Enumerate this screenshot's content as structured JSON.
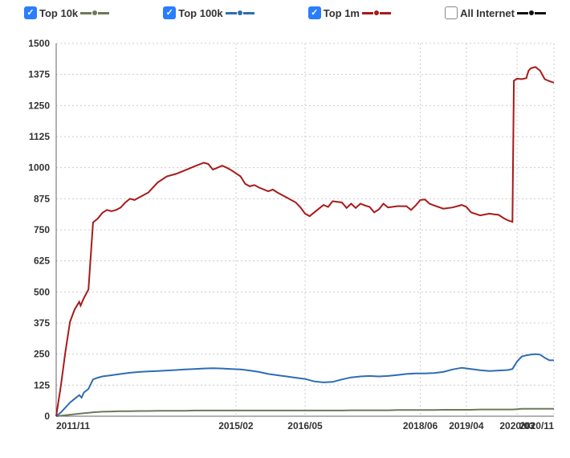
{
  "legend": {
    "items": [
      {
        "label": "Top 10k",
        "checked": true,
        "dot": "#6d7a5a",
        "line": "#6d7a5a"
      },
      {
        "label": "Top 100k",
        "checked": true,
        "dot": "#2e6db5",
        "line": "#2e6db5"
      },
      {
        "label": "Top 1m",
        "checked": true,
        "dot": "#a81a1a",
        "line": "#a81a1a"
      },
      {
        "label": "All Internet",
        "checked": false,
        "dot": "#111111",
        "line": "#111111"
      }
    ]
  },
  "chart_data": {
    "type": "line",
    "xlabel": "",
    "ylabel": "",
    "ylim": [
      0,
      1500
    ],
    "yticks": [
      0,
      125,
      250,
      375,
      500,
      625,
      750,
      875,
      1000,
      1125,
      1250,
      1375,
      1500
    ],
    "xticks": [
      {
        "t": 0,
        "label": "2011/11"
      },
      {
        "t": 39,
        "label": "2015/02"
      },
      {
        "t": 54,
        "label": "2016/05"
      },
      {
        "t": 79,
        "label": "2018/06"
      },
      {
        "t": 89,
        "label": "2019/04"
      },
      {
        "t": 100,
        "label": "2020/03"
      },
      {
        "t": 108,
        "label": "2020/11"
      }
    ],
    "x_range": [
      0,
      108
    ],
    "series": [
      {
        "name": "Top 10k",
        "color": "#6d7a5a",
        "points": [
          [
            0,
            0
          ],
          [
            1,
            2
          ],
          [
            2,
            4
          ],
          [
            3,
            6
          ],
          [
            4,
            8
          ],
          [
            5,
            10
          ],
          [
            6,
            12
          ],
          [
            7,
            14
          ],
          [
            8,
            16
          ],
          [
            9,
            17
          ],
          [
            10,
            18
          ],
          [
            12,
            19
          ],
          [
            14,
            20
          ],
          [
            16,
            20
          ],
          [
            18,
            21
          ],
          [
            20,
            21
          ],
          [
            22,
            22
          ],
          [
            24,
            22
          ],
          [
            26,
            22
          ],
          [
            28,
            22
          ],
          [
            30,
            23
          ],
          [
            32,
            23
          ],
          [
            34,
            23
          ],
          [
            36,
            23
          ],
          [
            38,
            23
          ],
          [
            40,
            23
          ],
          [
            42,
            23
          ],
          [
            44,
            23
          ],
          [
            46,
            23
          ],
          [
            48,
            23
          ],
          [
            50,
            23
          ],
          [
            52,
            23
          ],
          [
            54,
            23
          ],
          [
            56,
            23
          ],
          [
            58,
            23
          ],
          [
            60,
            23
          ],
          [
            62,
            23
          ],
          [
            64,
            24
          ],
          [
            66,
            24
          ],
          [
            68,
            24
          ],
          [
            70,
            24
          ],
          [
            72,
            24
          ],
          [
            74,
            25
          ],
          [
            76,
            25
          ],
          [
            78,
            25
          ],
          [
            80,
            25
          ],
          [
            82,
            25
          ],
          [
            84,
            26
          ],
          [
            86,
            26
          ],
          [
            88,
            26
          ],
          [
            90,
            26
          ],
          [
            92,
            27
          ],
          [
            94,
            27
          ],
          [
            96,
            27
          ],
          [
            98,
            27
          ],
          [
            99,
            27
          ],
          [
            100,
            28
          ],
          [
            101,
            30
          ],
          [
            102,
            30
          ],
          [
            103,
            30
          ],
          [
            104,
            30
          ],
          [
            105,
            30
          ],
          [
            106,
            30
          ],
          [
            107,
            30
          ],
          [
            108,
            30
          ]
        ]
      },
      {
        "name": "Top 100k",
        "color": "#2e6db5",
        "points": [
          [
            0,
            0
          ],
          [
            1,
            15
          ],
          [
            2,
            35
          ],
          [
            3,
            55
          ],
          [
            4,
            70
          ],
          [
            5,
            85
          ],
          [
            5.5,
            75
          ],
          [
            6,
            95
          ],
          [
            7,
            110
          ],
          [
            8,
            148
          ],
          [
            9,
            155
          ],
          [
            10,
            160
          ],
          [
            12,
            165
          ],
          [
            14,
            170
          ],
          [
            16,
            175
          ],
          [
            18,
            178
          ],
          [
            20,
            180
          ],
          [
            22,
            182
          ],
          [
            24,
            184
          ],
          [
            26,
            186
          ],
          [
            28,
            188
          ],
          [
            30,
            190
          ],
          [
            32,
            192
          ],
          [
            34,
            193
          ],
          [
            36,
            192
          ],
          [
            38,
            190
          ],
          [
            40,
            188
          ],
          [
            42,
            184
          ],
          [
            44,
            178
          ],
          [
            46,
            170
          ],
          [
            48,
            165
          ],
          [
            50,
            160
          ],
          [
            52,
            155
          ],
          [
            54,
            150
          ],
          [
            56,
            140
          ],
          [
            58,
            136
          ],
          [
            60,
            138
          ],
          [
            62,
            148
          ],
          [
            64,
            156
          ],
          [
            66,
            160
          ],
          [
            68,
            162
          ],
          [
            70,
            160
          ],
          [
            72,
            162
          ],
          [
            74,
            166
          ],
          [
            76,
            170
          ],
          [
            78,
            172
          ],
          [
            80,
            172
          ],
          [
            82,
            174
          ],
          [
            84,
            178
          ],
          [
            86,
            188
          ],
          [
            88,
            195
          ],
          [
            90,
            190
          ],
          [
            92,
            185
          ],
          [
            94,
            182
          ],
          [
            96,
            184
          ],
          [
            98,
            186
          ],
          [
            99,
            190
          ],
          [
            100,
            220
          ],
          [
            101,
            240
          ],
          [
            102,
            245
          ],
          [
            103,
            248
          ],
          [
            104,
            250
          ],
          [
            105,
            248
          ],
          [
            106,
            235
          ],
          [
            107,
            225
          ],
          [
            108,
            225
          ]
        ]
      },
      {
        "name": "Top 1m",
        "color": "#a81a1a",
        "points": [
          [
            0,
            0
          ],
          [
            1,
            120
          ],
          [
            2,
            260
          ],
          [
            3,
            380
          ],
          [
            4,
            430
          ],
          [
            5,
            460
          ],
          [
            5.3,
            445
          ],
          [
            6,
            475
          ],
          [
            7,
            510
          ],
          [
            8,
            780
          ],
          [
            9,
            795
          ],
          [
            10,
            818
          ],
          [
            11,
            830
          ],
          [
            12,
            825
          ],
          [
            13,
            830
          ],
          [
            14,
            840
          ],
          [
            15,
            860
          ],
          [
            16,
            875
          ],
          [
            17,
            870
          ],
          [
            18,
            880
          ],
          [
            20,
            900
          ],
          [
            22,
            940
          ],
          [
            24,
            965
          ],
          [
            26,
            975
          ],
          [
            28,
            990
          ],
          [
            30,
            1005
          ],
          [
            32,
            1020
          ],
          [
            33,
            1015
          ],
          [
            34,
            992
          ],
          [
            35,
            1000
          ],
          [
            36,
            1008
          ],
          [
            37,
            1000
          ],
          [
            38,
            990
          ],
          [
            40,
            965
          ],
          [
            41,
            935
          ],
          [
            42,
            925
          ],
          [
            43,
            930
          ],
          [
            44,
            920
          ],
          [
            46,
            905
          ],
          [
            47,
            912
          ],
          [
            48,
            900
          ],
          [
            50,
            880
          ],
          [
            52,
            860
          ],
          [
            53,
            840
          ],
          [
            54,
            815
          ],
          [
            55,
            805
          ],
          [
            56,
            820
          ],
          [
            57,
            835
          ],
          [
            58,
            850
          ],
          [
            59,
            842
          ],
          [
            60,
            865
          ],
          [
            62,
            860
          ],
          [
            63,
            838
          ],
          [
            64,
            855
          ],
          [
            65,
            838
          ],
          [
            66,
            855
          ],
          [
            67,
            848
          ],
          [
            68,
            842
          ],
          [
            69,
            820
          ],
          [
            70,
            832
          ],
          [
            71,
            855
          ],
          [
            72,
            840
          ],
          [
            74,
            845
          ],
          [
            76,
            845
          ],
          [
            77,
            830
          ],
          [
            78,
            848
          ],
          [
            79,
            870
          ],
          [
            80,
            872
          ],
          [
            81,
            855
          ],
          [
            82,
            848
          ],
          [
            84,
            835
          ],
          [
            86,
            840
          ],
          [
            88,
            850
          ],
          [
            89,
            842
          ],
          [
            90,
            820
          ],
          [
            92,
            808
          ],
          [
            94,
            815
          ],
          [
            95,
            812
          ],
          [
            96,
            810
          ],
          [
            97,
            798
          ],
          [
            98,
            788
          ],
          [
            99,
            782
          ],
          [
            99.3,
            1350
          ],
          [
            100,
            1358
          ],
          [
            101,
            1356
          ],
          [
            102,
            1360
          ],
          [
            102.5,
            1390
          ],
          [
            103,
            1400
          ],
          [
            104,
            1405
          ],
          [
            105,
            1390
          ],
          [
            106,
            1356
          ],
          [
            107,
            1348
          ],
          [
            108,
            1342
          ]
        ]
      }
    ]
  }
}
